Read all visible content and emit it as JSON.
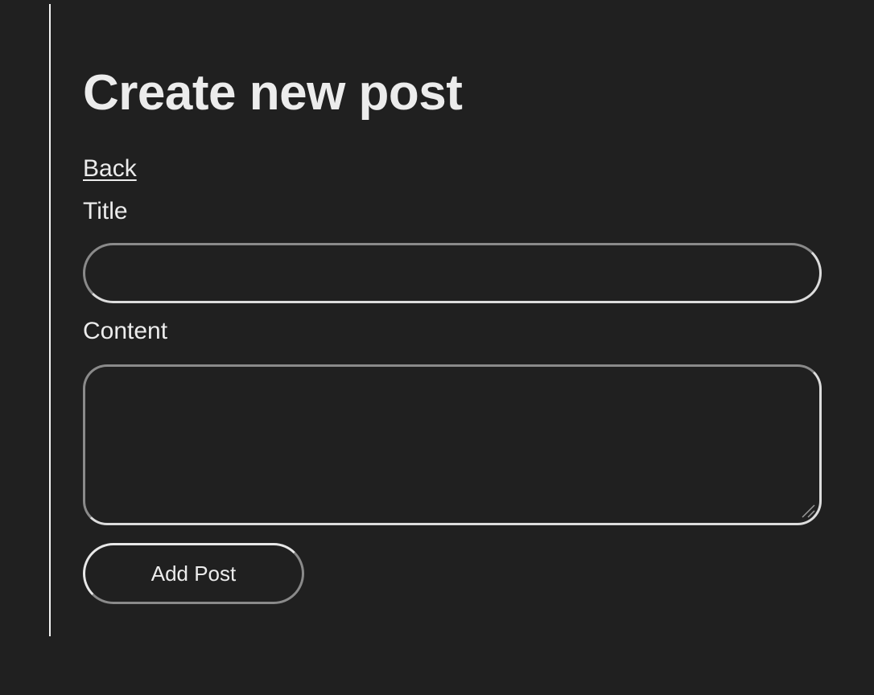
{
  "page": {
    "heading": "Create new post",
    "back_link": "Back"
  },
  "form": {
    "title_label": "Title",
    "title_value": "",
    "content_label": "Content",
    "content_value": "",
    "submit_label": "Add Post"
  },
  "colors": {
    "background": "#202020",
    "text": "#ececec",
    "rule": "#f2f2f2"
  }
}
